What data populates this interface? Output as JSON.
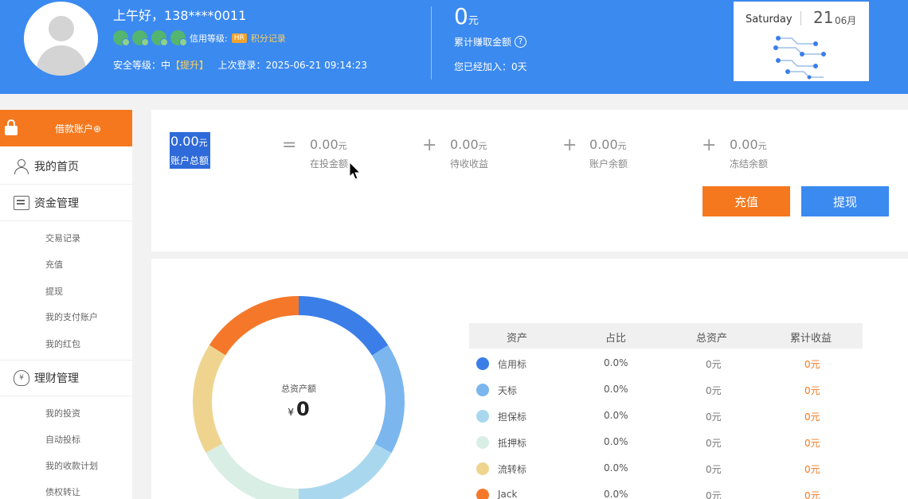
{
  "header": {
    "greeting": "上午好，138****0011",
    "credit_label": "信用等级:",
    "credit_grade": "HR",
    "points_link": "积分记录",
    "security_label": "安全等级：",
    "security_level": "中",
    "security_upgrade": "【提升】",
    "last_login_label": "上次登录：",
    "last_login_time": "2025-06-21 09:14:23",
    "total_earned_amount": "0",
    "total_earned_unit": "元",
    "total_earned_label": "累计赚取金额",
    "help_icon": "?",
    "joined_text": "您已经加入：0天"
  },
  "date_card": {
    "weekday": "Saturday",
    "day": "21",
    "month": "06月"
  },
  "sidebar": {
    "loan_account": "借款账户⊕",
    "home": "我的首页",
    "fund_management": "资金管理",
    "fund_items": [
      "交易记录",
      "充值",
      "提现",
      "我的支付账户",
      "我的红包"
    ],
    "wealth_management": "理财管理",
    "wealth_items": [
      "我的投资",
      "自动投标",
      "我的收款计划",
      "债权转让"
    ]
  },
  "summary": {
    "total": {
      "amount": "0.00",
      "unit": "元",
      "label": "账户总额"
    },
    "equals": "=",
    "plus": "+",
    "investing": {
      "amount": "0.00",
      "unit": "元",
      "label": "在投金额"
    },
    "pending": {
      "amount": "0.00",
      "unit": "元",
      "label": "待收收益"
    },
    "balance": {
      "amount": "0.00",
      "unit": "元",
      "label": "账户余额"
    },
    "frozen": {
      "amount": "0.00",
      "unit": "元",
      "label": "冻结余额"
    },
    "recharge_button": "充值",
    "withdraw_button": "提现"
  },
  "donut": {
    "label": "总资产额",
    "currency": "¥",
    "value": "0",
    "segments": [
      {
        "color": "#3b7ee8",
        "fraction": 0.16
      },
      {
        "color": "#7bb6ef",
        "fraction": 0.17
      },
      {
        "color": "#a9d8ee",
        "fraction": 0.17
      },
      {
        "color": "#d9eee4",
        "fraction": 0.17
      },
      {
        "color": "#efd490",
        "fraction": 0.17
      },
      {
        "color": "#f5782a",
        "fraction": 0.16
      }
    ]
  },
  "asset_table": {
    "headers": [
      "资产",
      "占比",
      "总资产",
      "累计收益"
    ],
    "rows": [
      {
        "name": "信用标",
        "pct": "0.0%",
        "total": "0元",
        "earned": "0元",
        "color": "#3b7ee8"
      },
      {
        "name": "天标",
        "pct": "0.0%",
        "total": "0元",
        "earned": "0元",
        "color": "#7bb6ef"
      },
      {
        "name": "担保标",
        "pct": "0.0%",
        "total": "0元",
        "earned": "0元",
        "color": "#a9d8ee"
      },
      {
        "name": "抵押标",
        "pct": "0.0%",
        "total": "0元",
        "earned": "0元",
        "color": "#d9eee4"
      },
      {
        "name": "流转标",
        "pct": "0.0%",
        "total": "0元",
        "earned": "0元",
        "color": "#efd490"
      },
      {
        "name": "Jack",
        "pct": "0.0%",
        "total": "0元",
        "earned": "0元",
        "color": "#f5782a"
      }
    ]
  }
}
